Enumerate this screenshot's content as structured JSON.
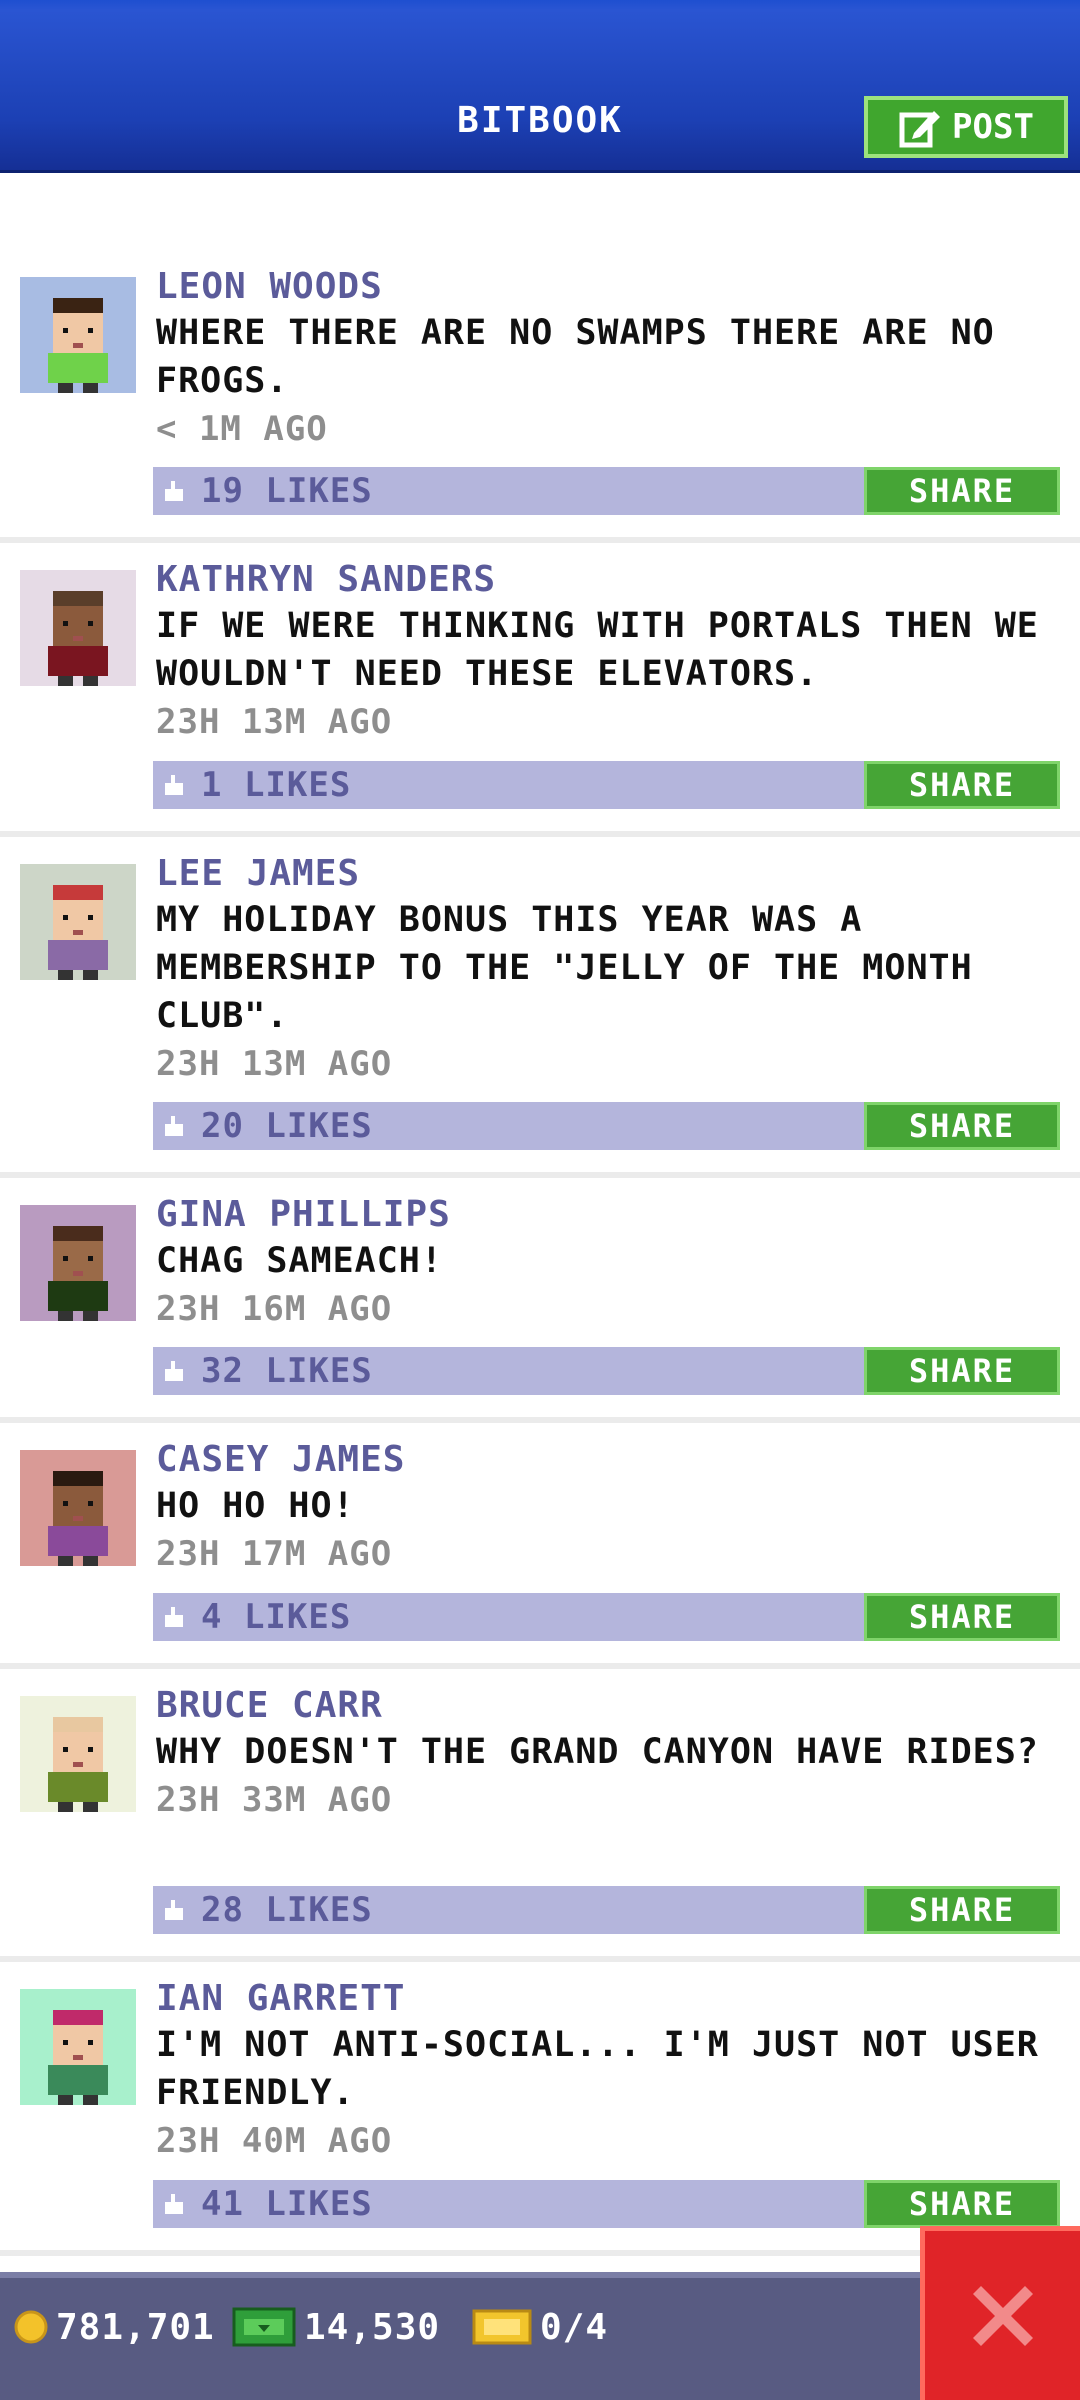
{
  "header": {
    "title": "BITBOOK",
    "post_label": "POST",
    "colors": {
      "bar": "#1c40b4",
      "post_button": "#40a62e"
    }
  },
  "share_label": "SHARE",
  "posts": [
    {
      "name": "LEON WOODS",
      "text": "WHERE THERE ARE NO SWAMPS THERE ARE NO FROGS.",
      "time": "< 1M AGO",
      "likes": "19 LIKES",
      "avatar_bg": "#a8bce3",
      "shirt": "#6fd24a",
      "hair": "#3a2313",
      "skin": "#f0c8a5"
    },
    {
      "name": "KATHRYN SANDERS",
      "text": "IF WE WERE THINKING WITH PORTALS THEN WE WOULDN'T NEED THESE ELEVATORS.",
      "time": "23H 13M AGO",
      "likes": "1 LIKES",
      "avatar_bg": "#e6dbe6",
      "shirt": "#7a1520",
      "hair": "#5a3e2a",
      "skin": "#8b5a3c"
    },
    {
      "name": "LEE JAMES",
      "text": "MY HOLIDAY BONUS THIS YEAR WAS A MEMBERSHIP TO THE \"JELLY OF THE MONTH CLUB\".",
      "time": "23H 13M AGO",
      "likes": "20 LIKES",
      "avatar_bg": "#cdd6c8",
      "shirt": "#8a6aa6",
      "hair": "#c63a3a",
      "skin": "#f0c8a5"
    },
    {
      "name": "GINA PHILLIPS",
      "text": "CHAG SAMEACH!",
      "time": "23H 16M AGO",
      "likes": "32 LIKES",
      "avatar_bg": "#b99bc0",
      "shirt": "#1e3a12",
      "hair": "#4a2c1c",
      "skin": "#9a6a48"
    },
    {
      "name": "CASEY JAMES",
      "text": "HO HO HO!",
      "time": "23H 17M AGO",
      "likes": "4 LIKES",
      "avatar_bg": "#d99a96",
      "shirt": "#8a4a9a",
      "hair": "#2a1a10",
      "skin": "#8b5a3c"
    },
    {
      "name": "BRUCE CARR",
      "text": "WHY DOESN'T THE GRAND CANYON HAVE RIDES?",
      "time": "23H 33M AGO",
      "likes": "28 LIKES",
      "avatar_bg": "#eef2dd",
      "shirt": "#6a8a2a",
      "hair": "#e8c8a0",
      "skin": "#f0c8a5"
    },
    {
      "name": "IAN GARRETT",
      "text": "I'M NOT ANTI-SOCIAL... I'M JUST NOT USER FRIENDLY.",
      "time": "23H 40M AGO",
      "likes": "41 LIKES",
      "avatar_bg": "#a8f0cc",
      "shirt": "#3a8a5a",
      "hair": "#c02a6a",
      "skin": "#f0c8a5"
    }
  ],
  "bottom_bar": {
    "coins": "781,701",
    "bux": "14,530",
    "tickets": "0/4"
  },
  "icons": {
    "post": "edit-icon",
    "like": "thumbs-up-icon",
    "coin": "coin-icon",
    "bux": "bux-icon",
    "ticket": "ticket-icon",
    "close": "close-icon"
  }
}
